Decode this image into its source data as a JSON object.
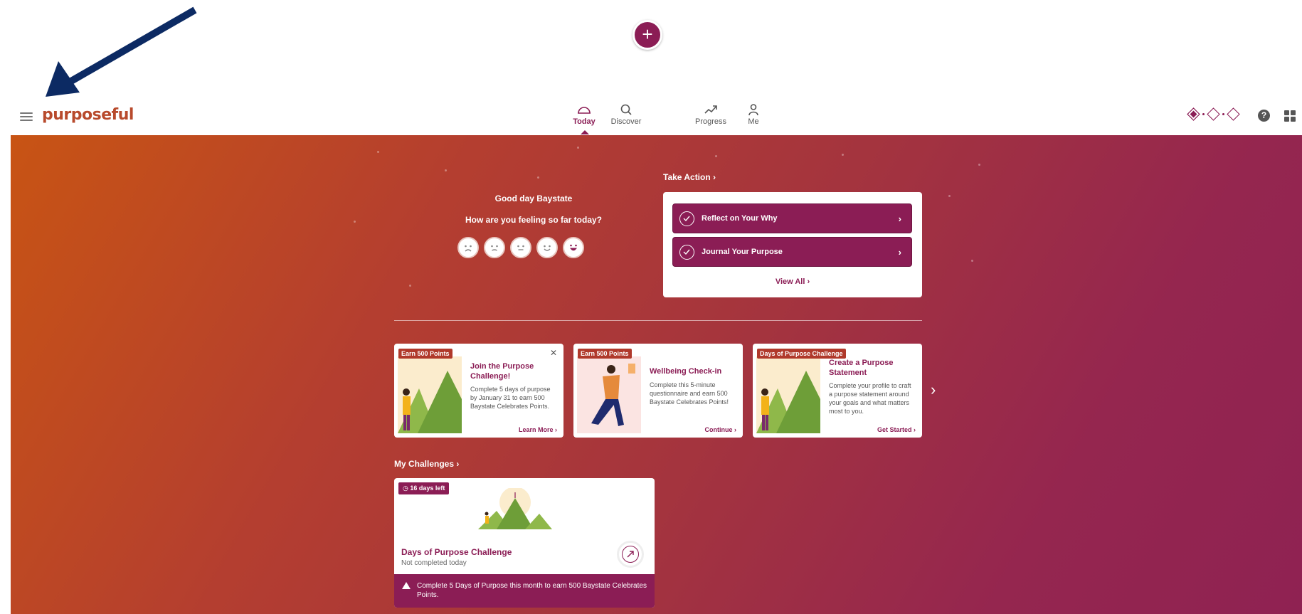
{
  "colors": {
    "brand": "#8b1d55",
    "logo": "#b84a2c",
    "annotation_arrow": "#0c2a63"
  },
  "nav": {
    "logo": "purposeful",
    "items": [
      {
        "label": "Today",
        "icon": "today-icon",
        "active": true
      },
      {
        "label": "Discover",
        "icon": "search-icon",
        "active": false
      },
      {
        "label": "Progress",
        "icon": "progress-icon",
        "active": false
      },
      {
        "label": "Me",
        "icon": "person-icon",
        "active": false
      }
    ],
    "add_label": "+",
    "help_label": "?"
  },
  "greeting": {
    "title": "Good day Baystate",
    "question": "How are you feeling so far today?",
    "moods": [
      "very-sad-face-icon",
      "sad-face-icon",
      "neutral-face-icon",
      "smile-face-icon",
      "laugh-face-icon"
    ]
  },
  "take_action": {
    "heading": "Take Action",
    "items": [
      {
        "label": "Reflect on Your Why"
      },
      {
        "label": "Journal Your Purpose"
      }
    ],
    "view_all": "View All"
  },
  "promos": [
    {
      "badge": "Earn 500 Points",
      "title": "Join the Purpose Challenge!",
      "desc": "Complete 5 days of purpose by January 31 to earn 500 Baystate Celebrates Points.",
      "cta": "Learn More"
    },
    {
      "badge": "Earn 500 Points",
      "title": "Wellbeing Check-in",
      "desc": "Complete this 5-minute questionnaire and earn 500 Baystate Celebrates Points!",
      "cta": "Continue"
    },
    {
      "badge": "Days of Purpose Challenge",
      "title": "Create a Purpose Statement",
      "desc": "Complete your profile to craft a purpose statement around your goals and what matters most to you.",
      "cta": "Get Started"
    }
  ],
  "challenges": {
    "heading": "My Challenges",
    "card": {
      "days_left": "16 days left",
      "title": "Days of Purpose Challenge",
      "status": "Not completed today",
      "footer": "Complete 5 Days of Purpose this month to earn 500 Baystate Celebrates Points."
    }
  }
}
